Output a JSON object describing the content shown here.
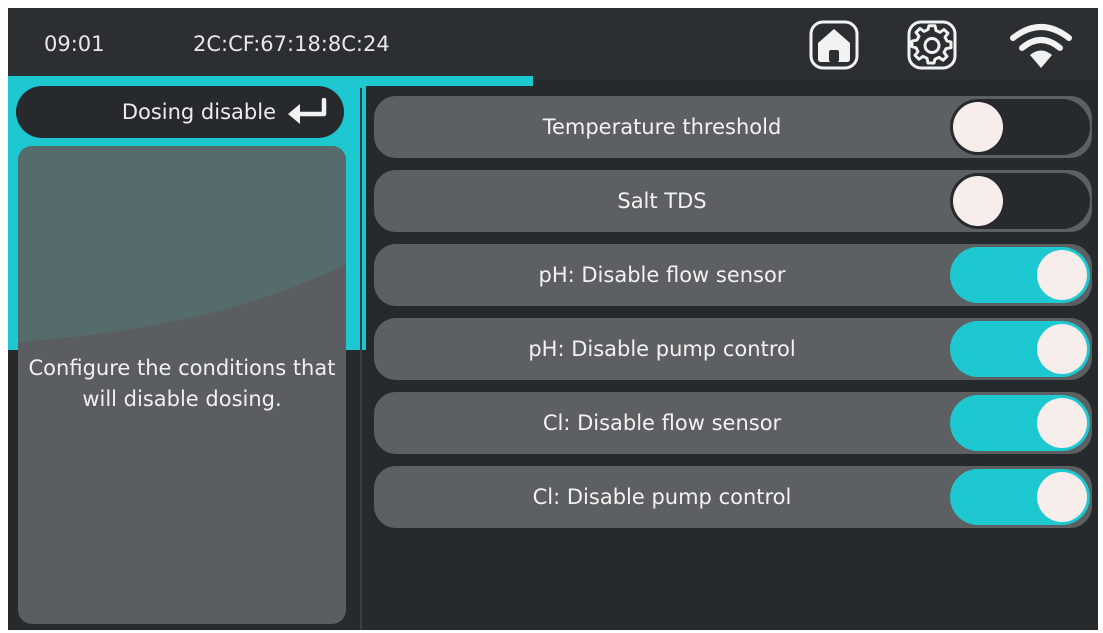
{
  "header": {
    "time": "09:01",
    "mac_address": "2C:CF:67:18:8C:24",
    "icons": [
      "home-icon",
      "gear-icon",
      "wifi-icon"
    ]
  },
  "panel": {
    "title": "Dosing disable",
    "description": "Configure the conditions that will disable dosing."
  },
  "settings": [
    {
      "label": "Temperature threshold",
      "enabled": false
    },
    {
      "label": "Salt TDS",
      "enabled": false
    },
    {
      "label": "pH: Disable flow sensor",
      "enabled": true
    },
    {
      "label": "pH: Disable pump control",
      "enabled": true
    },
    {
      "label": "Cl: Disable flow sensor",
      "enabled": true
    },
    {
      "label": "Cl: Disable pump control",
      "enabled": true
    }
  ],
  "colors": {
    "accent": "#1ec8d0",
    "background": "#262a2d",
    "row": "#5d6062",
    "knob": "#f7eeec"
  }
}
